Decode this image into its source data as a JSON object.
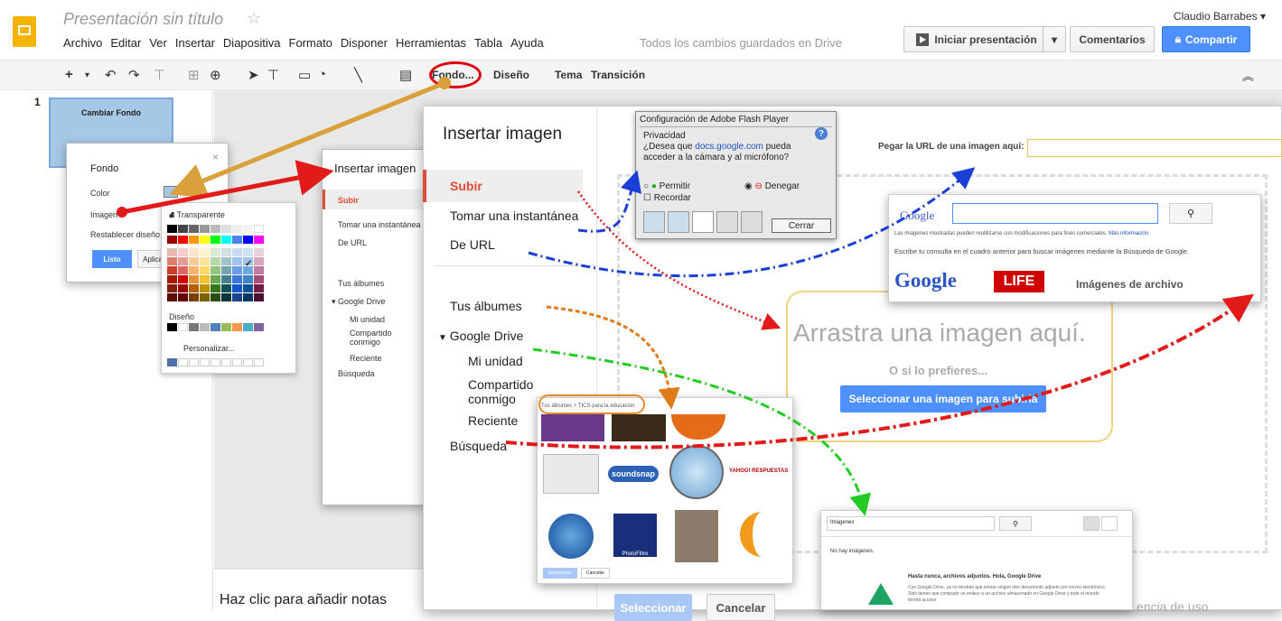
{
  "header": {
    "title": "Presentación sin título",
    "user": "Claudio Barrabes ▾",
    "save_status": "Todos los cambios guardados en Drive",
    "menu": [
      "Archivo",
      "Editar",
      "Ver",
      "Insertar",
      "Diapositiva",
      "Formato",
      "Disponer",
      "Herramientas",
      "Tabla",
      "Ayuda"
    ],
    "present_label": "Iniciar presentación",
    "comments_label": "Comentarios",
    "share_label": "Compartir"
  },
  "toolbar": {
    "fondo": "Fondo...",
    "diseno": "Diseño",
    "tema": "Tema",
    "transicion": "Transición"
  },
  "filmstrip": {
    "slide_number": "1",
    "slide_title": "Cambiar Fondo"
  },
  "notes_placeholder": "Haz clic para añadir notas",
  "bg_dialog": {
    "title": "Fondo",
    "color_label": "Color",
    "image_label": "Imagen",
    "reset_label": "Restablecer diseño",
    "done_label": "Listo",
    "apply_label": "Aplica"
  },
  "color_popup": {
    "transparent": "Transparente",
    "design": "Diseño",
    "custom": "Personalizar..."
  },
  "insert_small": {
    "title": "Insertar imagen",
    "items": [
      "Subir",
      "Tomar una instantánea",
      "De URL",
      "Tus álbumes",
      "Google Drive",
      "Mi unidad",
      "Compartido conmigo",
      "Reciente",
      "Búsqueda"
    ]
  },
  "insert_main": {
    "title": "Insertar imagen",
    "nav": {
      "upload": "Subir",
      "snapshot": "Tomar una instantánea",
      "url": "De URL",
      "albums": "Tus álbumes",
      "drive": "Google Drive",
      "my_drive": "Mi unidad",
      "shared": "Compartido conmigo",
      "recent": "Reciente",
      "search": "Búsqueda"
    },
    "url_label": "Pegar la URL de una imagen aquí:",
    "drop_text": "Arrastra una imagen aquí.",
    "or_text": "O si lo prefieres...",
    "select_button": "Seleccionar una imagen para subirla",
    "select_footer": "Seleccionar",
    "cancel_footer": "Cancelar",
    "usage_text": "encia de uso"
  },
  "flash": {
    "title": "Configuración de Adobe Flash Player",
    "section": "Privacidad",
    "question_pre": "¿Desea que ",
    "domain": "docs.google.com",
    "question_post": " pueda acceder a la cámara y al micrófono?",
    "allow": "Permitir",
    "deny": "Denegar",
    "remember": "Recordar",
    "close": "Cerrar"
  },
  "google_search": {
    "logo": "Google",
    "notice": "Las imágenes mostradas pueden reutilizarse con modificaciones para fines comerciales.",
    "more_info": "Más información",
    "hint": "Escribe tu consulta en el cuadro anterior para buscar imágenes mediante la Búsqueda de Google.",
    "life": "LIFE",
    "stock": "Imágenes de archivo"
  },
  "albums_panel": {
    "breadcrumb": "Tus álbumes > TICS para la educación",
    "select": "Seleccionar",
    "cancel": "Cancelar",
    "labels": [
      "soundsnap",
      "YAHOO! RESPUESTAS",
      "PhotoFiltre"
    ]
  },
  "drive_panel": {
    "search_value": "Imágenes",
    "empty": "No hay imágenes.",
    "promo_title": "Hasta nunca, archivos adjuntos. Hola, Google Drive",
    "promo_text": "Con Google Drive, ya no tendrás que enviar ningún otro documento adjunto por correo electrónico. Solo tienes que compartir un enlace a un archivo almacenado en Google Drive y todo el mundo tendrá acceso"
  },
  "colors": {
    "accent": "#4d90fe",
    "red_arrow": "#e21a1a",
    "blue_arrow": "#1b3fd6",
    "orange_arrow": "#e07b1a",
    "green_arrow": "#22cc22",
    "tan_arrow": "#d9a03c"
  }
}
